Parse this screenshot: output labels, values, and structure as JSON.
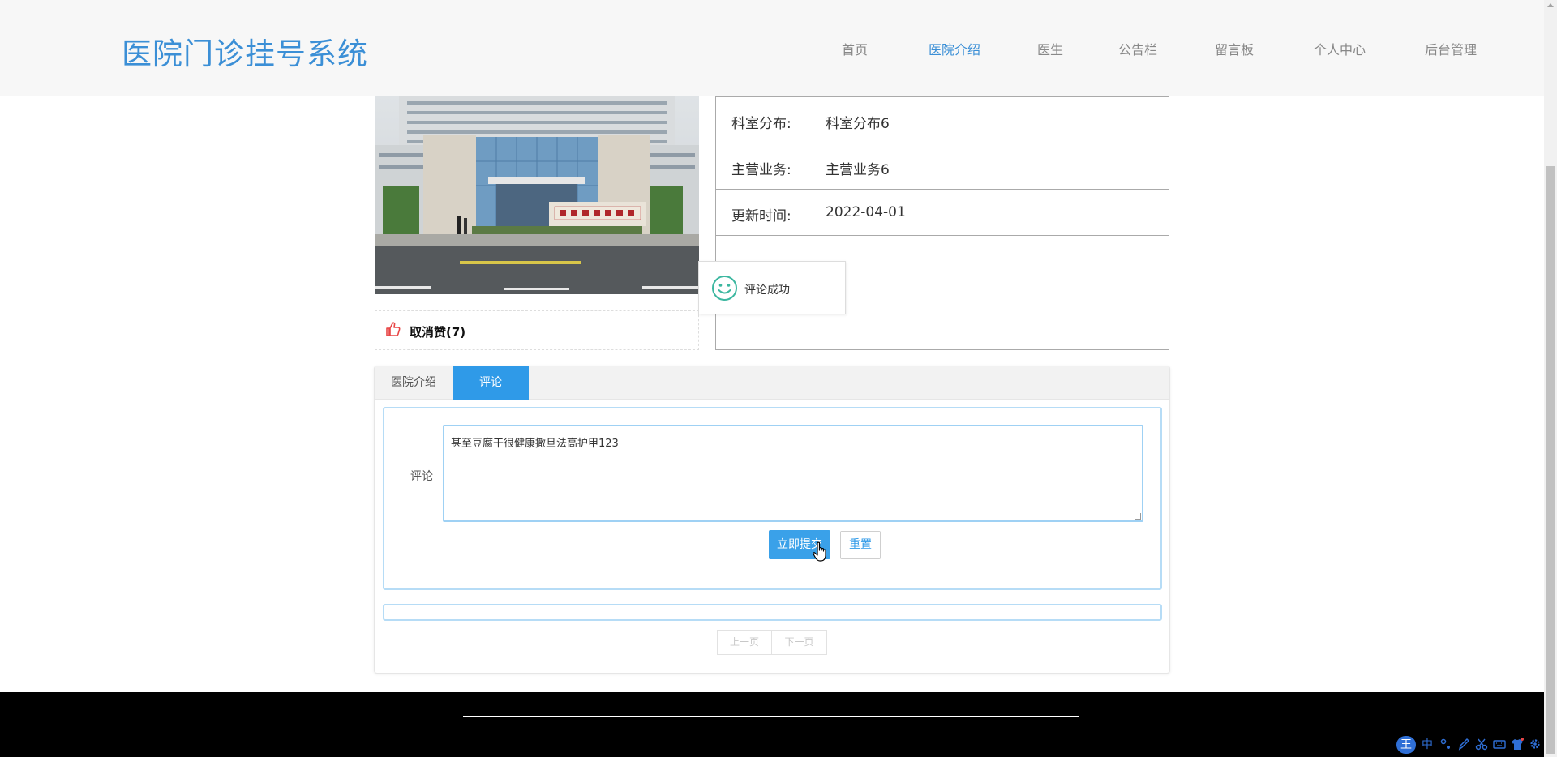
{
  "header": {
    "logo": "医院门诊挂号系统",
    "nav": [
      {
        "label": "首页"
      },
      {
        "label": "医院介绍",
        "active": true
      },
      {
        "label": "医生"
      },
      {
        "label": "公告栏"
      },
      {
        "label": "留言板"
      },
      {
        "label": "个人中心"
      },
      {
        "label": "后台管理"
      }
    ]
  },
  "detail": {
    "like_label": "取消赞(7)",
    "info": [
      {
        "key": "科室分布:",
        "value": "科室分布6"
      },
      {
        "key": "主营业务:",
        "value": "主营业务6"
      },
      {
        "key": "更新时间:",
        "value": "2022-04-01"
      }
    ]
  },
  "toast": {
    "message": "评论成功"
  },
  "tabs": [
    {
      "label": "医院介绍"
    },
    {
      "label": "评论",
      "active": true
    }
  ],
  "comment_form": {
    "label": "评论",
    "value": "甚至豆腐干很健康撒旦法高护甲123",
    "submit_label": "立即提交",
    "reset_label": "重置"
  },
  "pager": {
    "prev_label": "上一页",
    "next_label": "下一页"
  },
  "ime": {
    "logo": "王",
    "mode": "中"
  },
  "colors": {
    "accent": "#2f9ae8",
    "logo": "#3b8fd6",
    "header_bg": "#f7f7f7",
    "footer_bg": "#000000"
  }
}
